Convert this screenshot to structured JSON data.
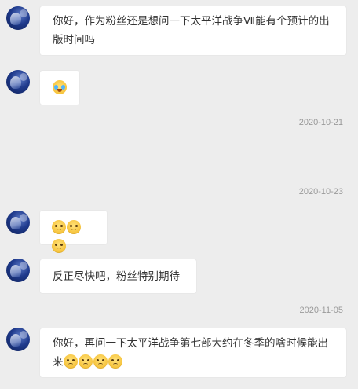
{
  "messages": [
    {
      "text": "你好，作为粉丝还是想问一下太平洋战争Ⅶ能有个预计的出版时间吗"
    },
    {
      "emoji": "cry-laugh-emoji"
    },
    {
      "emojis": [
        "sad-face-emoji",
        "sad-face-emoji",
        "sad-face-emoji"
      ]
    },
    {
      "text": "反正尽快吧，粉丝特别期待"
    },
    {
      "text": "你好，再问一下太平洋战争第七部大约在冬季的啥时候能出来"
    }
  ],
  "timestamps": [
    "2020-10-21",
    "2020-10-23",
    "2020-11-05"
  ],
  "colors": {
    "background": "#ededed",
    "bubble": "#ffffff",
    "timestamp": "#9a9a9a"
  }
}
